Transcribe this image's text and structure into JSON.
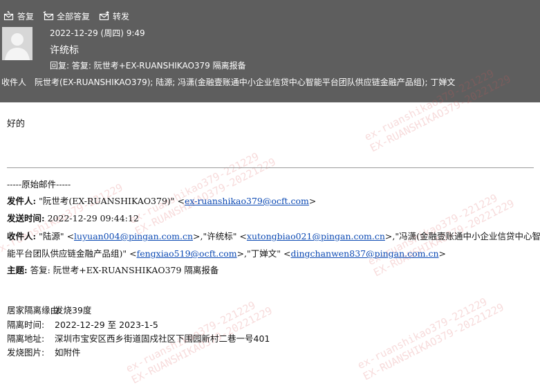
{
  "toolbar": {
    "reply_label": "答复",
    "reply_all_label": "全部答复",
    "forward_label": "转发"
  },
  "message": {
    "date": "2022-12-29 (周四) 9:49",
    "sender": "许统标",
    "subject": "回复: 答复: 阮世考+EX-RUANSHIKAO379 隔离报备",
    "recipients_label": "收件人",
    "recipients": "阮世考(EX-RUANSHIKAO379); 陆源; 冯潇(金融壹账通中小企业信贷中心智能平台团队供应链金融产品组); 丁婵文"
  },
  "body": {
    "reply_text": "好的",
    "original_header": "-----原始邮件-----",
    "from_label": "发件人:",
    "from_name": " \"阮世考(EX-RUANSHIKAO379)\" <",
    "from_email": "ex-ruanshikao379@ocft.com",
    "from_tail": ">",
    "sent_label": "发送时间:",
    "sent_value": " 2022-12-29 09:44:12",
    "to_label": "收件人:",
    "to_1_name": " \"陆源\" <",
    "to_1_email": "luyuan004@pingan.com.cn",
    "to_2_name": ">,\"许统标\" <",
    "to_2_email": "xutongbiao021@pingan.com.cn",
    "to_3_name": ">,\"冯潇(金融壹账通中小企业信贷中心智",
    "to_3_cont": "能平台团队供应链金融产品组)\" <",
    "to_3_email": "fengxiao519@ocft.com",
    "to_4_name": ">,\"丁婵文\" <",
    "to_4_email": "dingchanwen837@pingan.com.cn",
    "to_4_tail": ">",
    "subject_label": "主题:",
    "subject_value": " 答复: 阮世考+EX-RUANSHIKAO379 隔离报备",
    "fields": [
      {
        "key": "居家隔离缘由:",
        "value": "发烧39度"
      },
      {
        "key": "隔离时间:",
        "value": "2022-12-29 至 2023-1-5"
      },
      {
        "key": "隔离地址:",
        "value": "深圳市宝安区西乡街道固戍社区下围园新村二巷一号401"
      },
      {
        "key": "发烧图片:",
        "value": "如附件"
      }
    ]
  },
  "watermark": {
    "line1": "ex-ruanshikao379-221229",
    "line2": "EX-RUANSHIKAO379-20221229"
  },
  "colors": {
    "header_bg": "#5e5e5e",
    "link": "#0b49b3",
    "watermark": "#dc5a5a"
  }
}
